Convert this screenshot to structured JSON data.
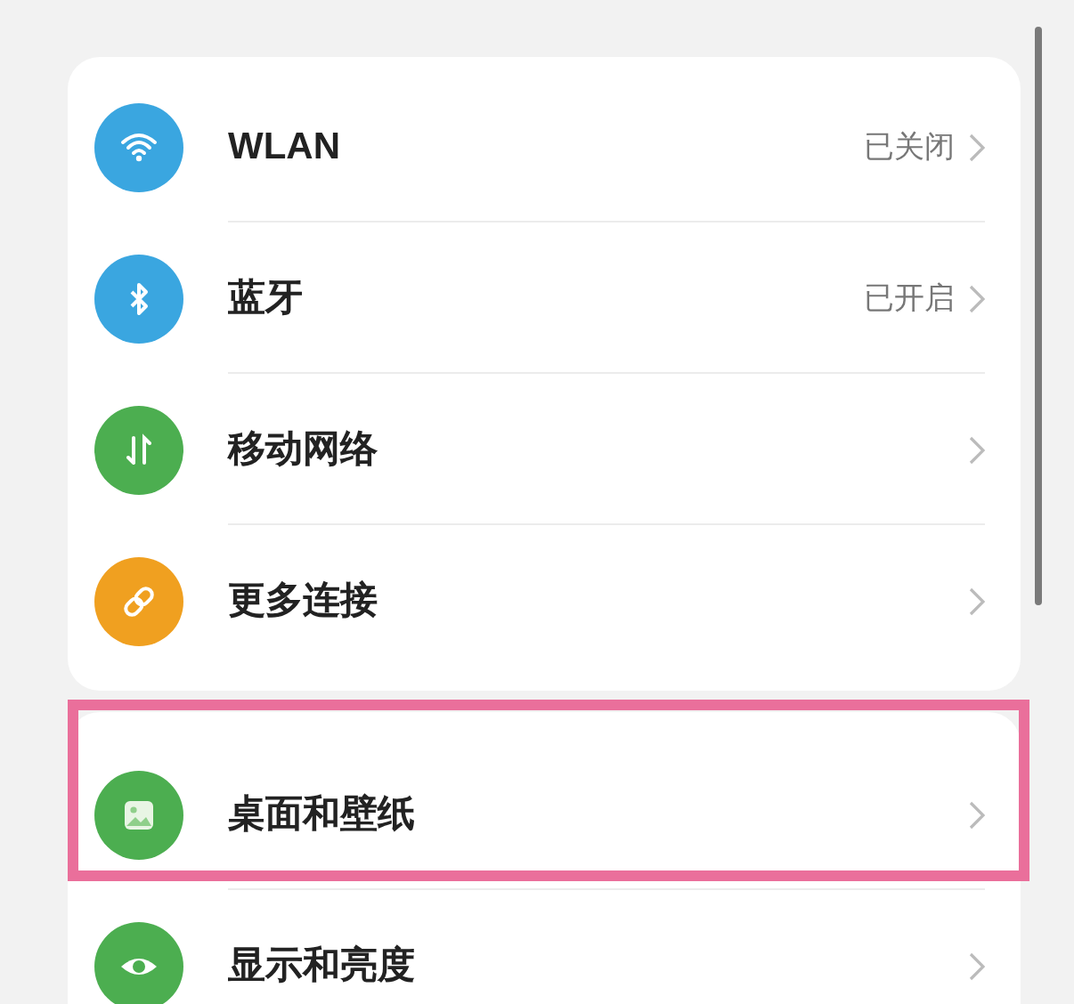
{
  "groups": [
    {
      "items": [
        {
          "kind": "wifi",
          "color": "#3aa6e0",
          "label": "WLAN",
          "value": "已关闭"
        },
        {
          "kind": "bluetooth",
          "color": "#3aa6e0",
          "label": "蓝牙",
          "value": "已开启"
        },
        {
          "kind": "data",
          "color": "#4cae50",
          "label": "移动网络"
        },
        {
          "kind": "link",
          "color": "#f0a020",
          "label": "更多连接"
        }
      ]
    },
    {
      "items": [
        {
          "kind": "image",
          "color": "#4cae50",
          "label": "桌面和壁纸",
          "highlighted": true
        },
        {
          "kind": "eye",
          "color": "#4cae50",
          "label": "显示和亮度",
          "highlighted": false
        }
      ]
    }
  ]
}
